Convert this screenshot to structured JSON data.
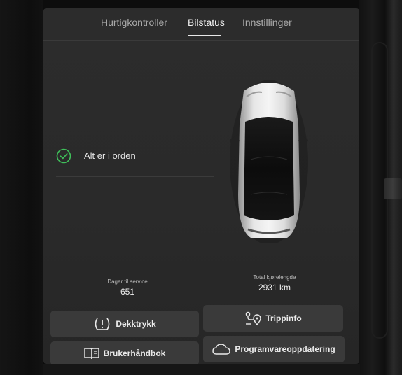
{
  "tabs": [
    {
      "label": "Hurtigkontroller",
      "active": false
    },
    {
      "label": "Bilstatus",
      "active": true
    },
    {
      "label": "Innstillinger",
      "active": false
    }
  ],
  "status": {
    "text": "Alt er i orden",
    "icon": "check-circle-icon",
    "color": "#3fbf5a"
  },
  "service": {
    "label": "Dager til service",
    "value": "651"
  },
  "mileage": {
    "label": "Total kjørelengde",
    "value": "2931 km"
  },
  "buttons": {
    "tire_pressure": {
      "label": "Dekktrykk",
      "icon": "tire-pressure-warning-icon"
    },
    "trip_info": {
      "label": "Trippinfo",
      "icon": "route-icon"
    },
    "manual": {
      "label": "Brukerhåndbok",
      "icon": "book-icon"
    },
    "software_update": {
      "label": "Programvareoppdatering",
      "icon": "cloud-icon"
    }
  }
}
